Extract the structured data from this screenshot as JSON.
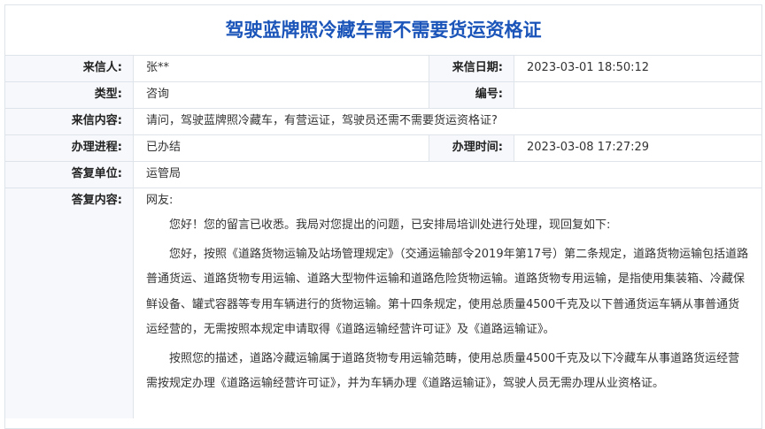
{
  "title": "驾驶蓝牌照冷藏车需不需要货运资格证",
  "rows": {
    "sender": {
      "label": "来信人:",
      "value": "张**"
    },
    "date": {
      "label": "来信日期:",
      "value": "2023-03-01 18:50:12"
    },
    "type": {
      "label": "类型:",
      "value": "咨询"
    },
    "number": {
      "label": "编号:",
      "value": ""
    },
    "content": {
      "label": "来信内容:",
      "value": "请问，驾驶蓝牌照冷藏车，有营运证，驾驶员还需不需要货运资格证?"
    },
    "progress": {
      "label": "办理进程:",
      "value": "已办结"
    },
    "handle_time": {
      "label": "办理时间:",
      "value": "2023-03-08 17:27:29"
    },
    "unit": {
      "label": "答复单位:",
      "value": "运管局"
    },
    "reply": {
      "label": "答复内容:",
      "greeting": "网友:",
      "paragraphs": [
        "您好！您的留言已收悉。我局对您提出的问题，已安排局培训处进行处理，现回复如下:",
        "您好，按照《道路货物运输及站场管理规定》（交通运输部令2019年第17号）第二条规定，道路货物运输包括道路普通货运、道路货物专用运输、道路大型物件运输和道路危险货物运输。道路货物专用运输，是指使用集装箱、冷藏保鲜设备、罐式容器等专用车辆进行的货物运输。第十四条规定，使用总质量4500千克及以下普通货运车辆从事普通货运经营的，无需按照本规定申请取得《道路运输经营许可证》及《道路运输证》。",
        "按照您的描述，道路冷藏运输属于道路货物专用运输范畴，使用总质量4500千克及以下冷藏车从事道路货运经营需按规定办理《道路运输经营许可证》，并为车辆办理《道路运输证》，驾驶人员无需办理从业资格证。"
      ]
    }
  }
}
